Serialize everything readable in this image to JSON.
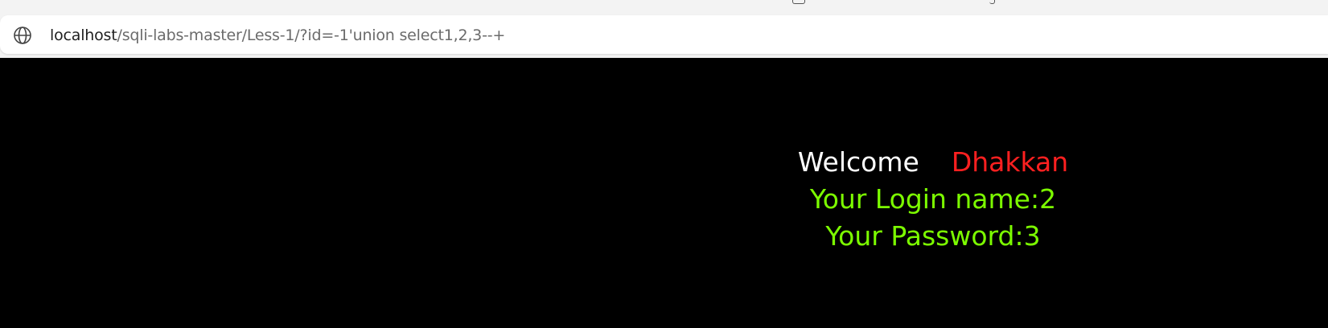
{
  "browser": {
    "url_host": "localhost",
    "url_path": "/sqli-labs-master/Less-1/?id=-1'union select1,2,3--+",
    "address_icon": "globe-icon"
  },
  "page": {
    "welcome_label": "Welcome",
    "username": "Dhakkan",
    "login_name_text": "Your Login name:2",
    "password_text": "Your Password:3",
    "colors": {
      "background": "#000000",
      "welcome": "#ffffff",
      "username": "#ff2020",
      "result": "#7cfc00"
    }
  }
}
